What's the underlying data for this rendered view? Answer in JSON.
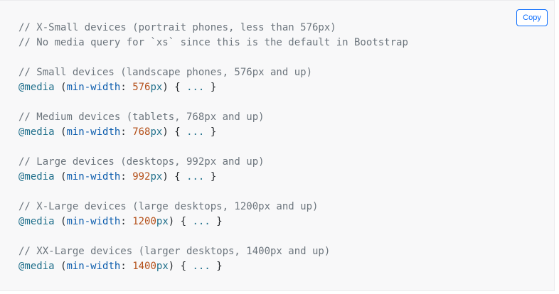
{
  "copy_button": {
    "label": "Copy"
  },
  "code": {
    "intro_comments": [
      "// X-Small devices (portrait phones, less than 576px)",
      "// No media query for `xs` since this is the default in Bootstrap"
    ],
    "blocks": [
      {
        "comment": "// Small devices (landscape phones, 576px and up)",
        "keyword": "@media",
        "open_paren": "(",
        "property": "min-width",
        "colon": ":",
        "value": "576",
        "unit": "px",
        "close": ") {",
        "ellipsis": "...",
        "end": "}"
      },
      {
        "comment": "// Medium devices (tablets, 768px and up)",
        "keyword": "@media",
        "open_paren": "(",
        "property": "min-width",
        "colon": ":",
        "value": "768",
        "unit": "px",
        "close": ") {",
        "ellipsis": "...",
        "end": "}"
      },
      {
        "comment": "// Large devices (desktops, 992px and up)",
        "keyword": "@media",
        "open_paren": "(",
        "property": "min-width",
        "colon": ":",
        "value": "992",
        "unit": "px",
        "close": ") {",
        "ellipsis": "...",
        "end": "}"
      },
      {
        "comment": "// X-Large devices (large desktops, 1200px and up)",
        "keyword": "@media",
        "open_paren": "(",
        "property": "min-width",
        "colon": ":",
        "value": "1200",
        "unit": "px",
        "close": ") {",
        "ellipsis": "...",
        "end": "}"
      },
      {
        "comment": "// XX-Large devices (larger desktops, 1400px and up)",
        "keyword": "@media",
        "open_paren": "(",
        "property": "min-width",
        "colon": ":",
        "value": "1400",
        "unit": "px",
        "close": ") {",
        "ellipsis": "...",
        "end": "}"
      }
    ]
  },
  "colors": {
    "comment": "#6c757d",
    "keyword": "#1f6f8b",
    "property": "#0b5cad",
    "number": "#b4501a",
    "button": "#0d6efd"
  }
}
